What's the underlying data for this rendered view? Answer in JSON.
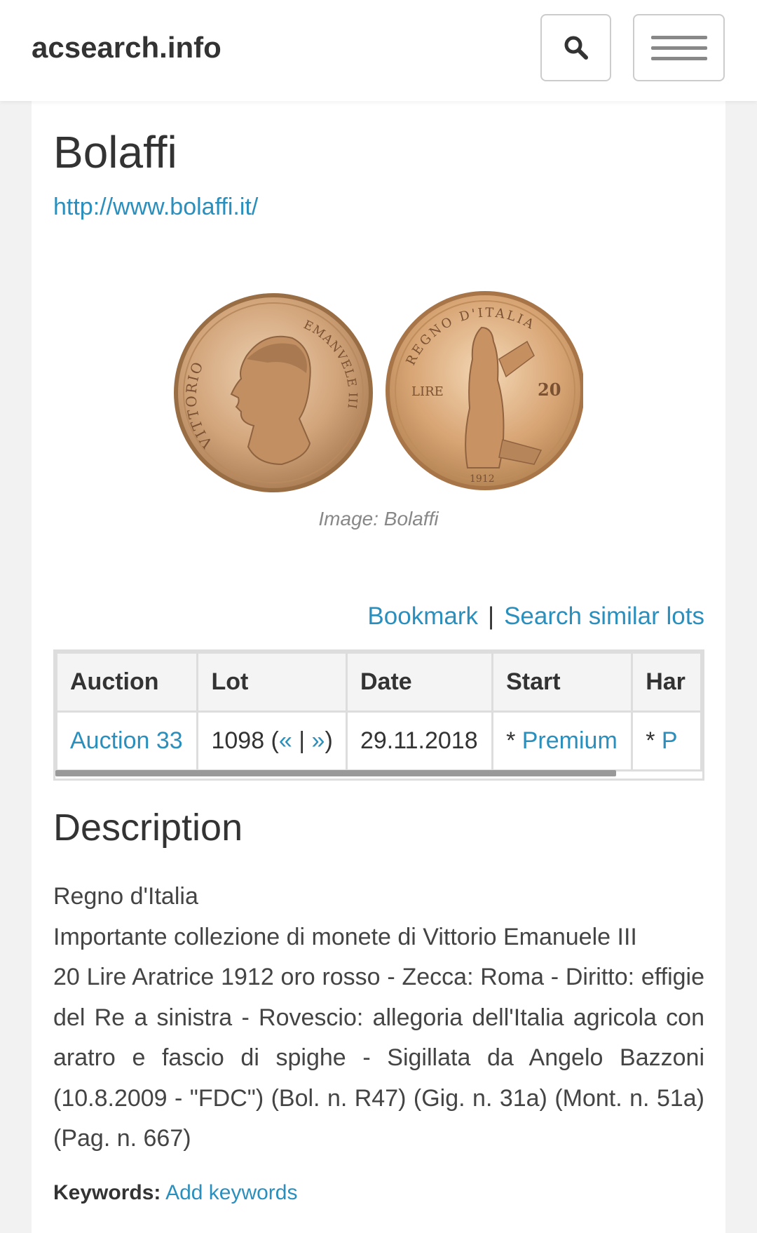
{
  "header": {
    "brand": "acsearch.info",
    "search_icon": "search-icon",
    "menu_icon": "hamburger-menu-icon"
  },
  "auction_house": {
    "name": "Bolaffi",
    "website": "http://www.bolaffi.it/"
  },
  "image": {
    "caption": "Image: Bolaffi",
    "obverse_legend_left": "VITTORIO",
    "obverse_legend_right": "EMANVELE III",
    "reverse_legend": "REGNO D'ITALIA",
    "reverse_lire": "LIRE",
    "reverse_value": "20",
    "reverse_year": "1912"
  },
  "actions": {
    "bookmark": "Bookmark",
    "separator": "|",
    "search_similar": "Search similar lots"
  },
  "table": {
    "headers": [
      "Auction",
      "Lot",
      "Date",
      "Start",
      "Har"
    ],
    "row": {
      "auction": "Auction 33",
      "lot_number": "1098 (",
      "lot_prev": "«",
      "lot_sep": " | ",
      "lot_next": "»",
      "lot_close": ")",
      "date": "29.11.2018",
      "start_prefix": "* ",
      "start_link": "Premium",
      "hammer_prefix": "* ",
      "hammer_link": "P"
    }
  },
  "description": {
    "title": "Description",
    "line1": "Regno d'Italia",
    "line2": "Importante collezione di monete di Vittorio Emanuele III",
    "paragraph": "20 Lire Aratrice 1912 oro rosso - Zecca: Roma - Diritto: effigie del Re a sinistra - Rovescio: allegoria dell'Italia agricola con aratro e fascio di spighe - Sigillata da Angelo Bazzoni (10.8.2009 - \"FDC\") (Bol. n. R47) (Gig. n. 31a) (Mont. n. 51a) (Pag. n. 667)"
  },
  "keywords": {
    "label": "Keywords:",
    "add": "Add keywords"
  },
  "colors": {
    "link": "#2a8fbd",
    "gold": "#c99a6a"
  }
}
